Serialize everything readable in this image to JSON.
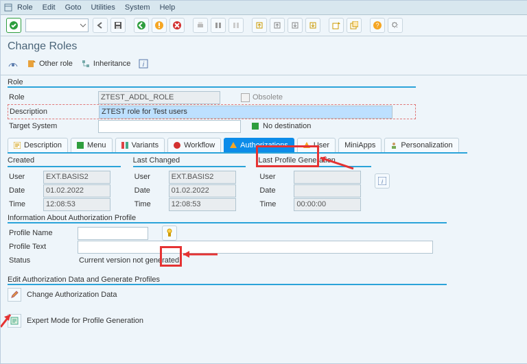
{
  "menubar": {
    "items": [
      "Role",
      "Edit",
      "Goto",
      "Utilities",
      "System",
      "Help"
    ]
  },
  "title": "Change Roles",
  "subbar": {
    "other_role": "Other role",
    "inheritance": "Inheritance"
  },
  "role_group": {
    "header": "Role",
    "role_label": "Role",
    "role_value": "ZTEST_ADDL_ROLE",
    "obsolete_label": "Obsolete",
    "desc_label": "Description",
    "desc_value": "ZTEST role for Test users",
    "target_label": "Target System",
    "target_value": "",
    "no_dest": "No destination"
  },
  "tabs": {
    "description": "Description",
    "menu": "Menu",
    "variants": "Variants",
    "workflow": "Workflow",
    "authorizations": "Authorizations",
    "user": "User",
    "miniapps": "MiniApps",
    "personalization": "Personalization"
  },
  "meta": {
    "created_hdr": "Created",
    "lastchg_hdr": "Last Changed",
    "lastprof_hdr": "Last Profile Generation",
    "user_label": "User",
    "date_label": "Date",
    "time_label": "Time",
    "created": {
      "user": "EXT.BASIS2",
      "date": "01.02.2022",
      "time": "12:08:53"
    },
    "lastchg": {
      "user": "EXT.BASIS2",
      "date": "01.02.2022",
      "time": "12:08:53"
    },
    "lastprof": {
      "user": "",
      "date": "",
      "time": "00:00:00"
    }
  },
  "authprof": {
    "header": "Information About Authorization Profile",
    "name_label": "Profile Name",
    "name_value": "",
    "text_label": "Profile Text",
    "text_value": "",
    "status_label": "Status",
    "status_value": "Current version not generated"
  },
  "editauth": {
    "header": "Edit Authorization Data and Generate Profiles",
    "change": "Change Authorization Data",
    "expert": "Expert Mode for Profile Generation"
  },
  "colors": {
    "green": "#2e9e3e",
    "red": "#d23030",
    "yellow": "#f5a623",
    "blue": "#0c8ce9"
  }
}
